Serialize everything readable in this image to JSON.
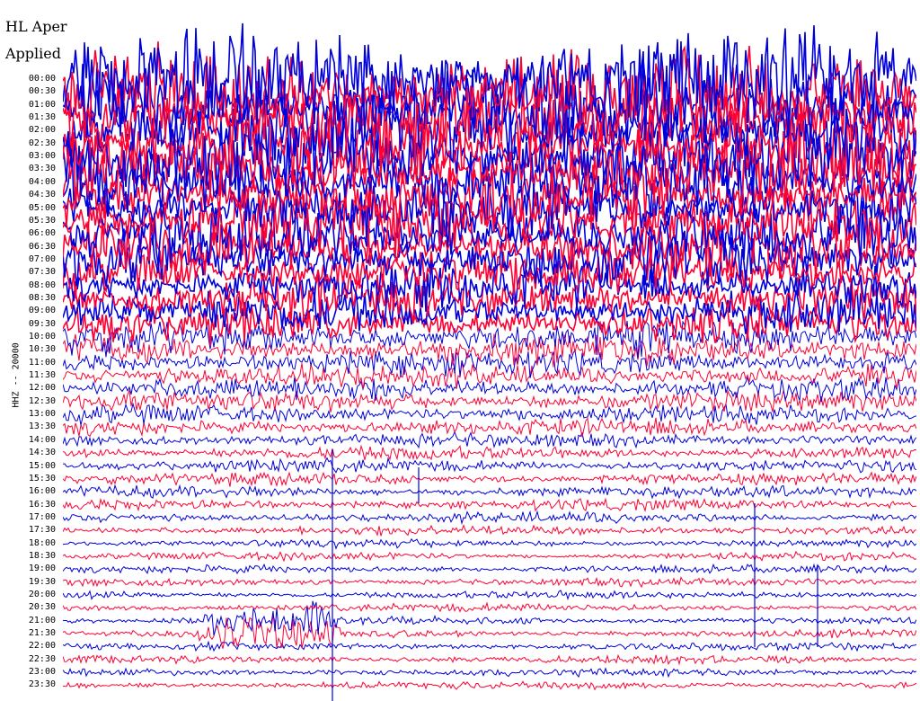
{
  "title_lines": [
    "HL Aper",
    "Applied"
  ],
  "station_label": "HHZ -- 20000",
  "time_labels": [
    "00:00",
    "00:30",
    "01:00",
    "01:30",
    "02:00",
    "02:30",
    "03:00",
    "03:30",
    "04:00",
    "04:30",
    "05:00",
    "05:30",
    "06:00",
    "06:30",
    "07:00",
    "07:30",
    "08:00",
    "08:30",
    "09:00",
    "09:30",
    "10:00",
    "10:30",
    "11:00",
    "11:30",
    "12:00",
    "12:30",
    "13:00",
    "13:30",
    "14:00",
    "14:30",
    "15:00",
    "15:30",
    "16:00",
    "16:30",
    "17:00",
    "17:30",
    "18:00",
    "18:30",
    "19:00",
    "19:30",
    "20:00",
    "20:30",
    "21:00",
    "21:30",
    "22:00",
    "22:30",
    "23:00",
    "23:30"
  ],
  "colors": {
    "trace_a": "#ff0033",
    "trace_b": "#0000dd",
    "background": "#ffffff"
  }
}
